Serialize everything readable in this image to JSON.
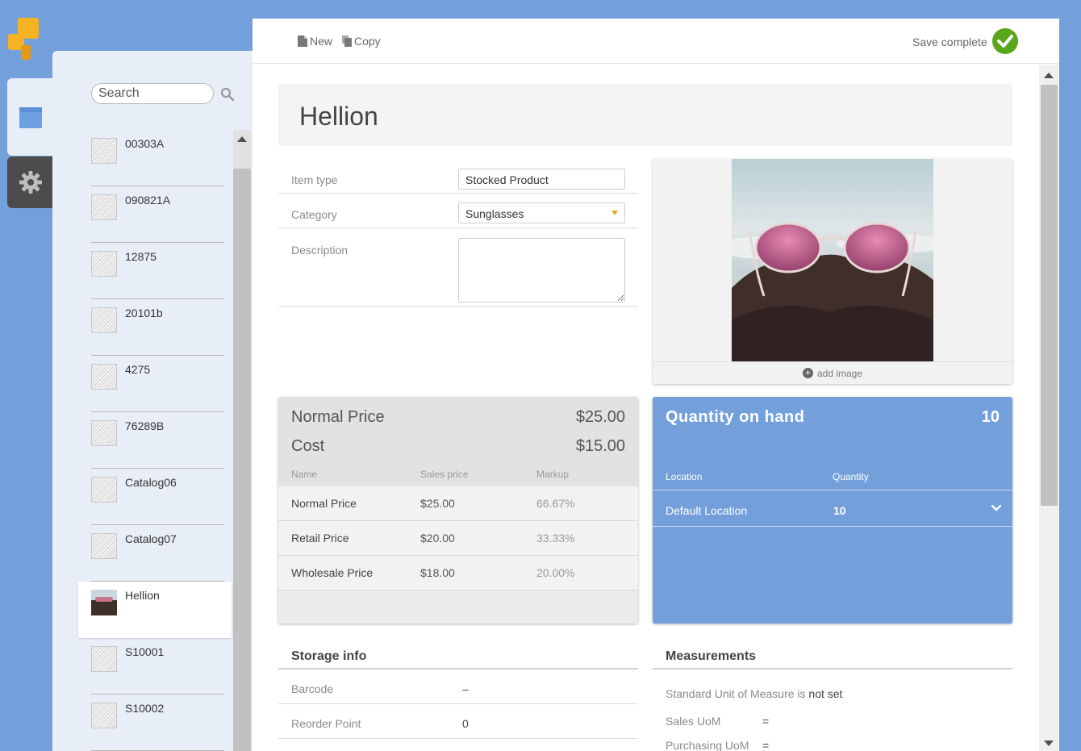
{
  "app": {
    "brand_color": "#f4b224",
    "accent": "#739fdb"
  },
  "rail": {
    "items_icon": "box-icon",
    "settings_icon": "gear-icon"
  },
  "search": {
    "placeholder": "Search"
  },
  "items": [
    {
      "code": "00303A"
    },
    {
      "code": "090821A"
    },
    {
      "code": "12875"
    },
    {
      "code": "20101b"
    },
    {
      "code": "4275"
    },
    {
      "code": "76289B"
    },
    {
      "code": "Catalog06"
    },
    {
      "code": "Catalog07"
    },
    {
      "code": "Hellion",
      "selected": true
    },
    {
      "code": "S10001"
    },
    {
      "code": "S10002"
    }
  ],
  "toolbar": {
    "new_label": "New",
    "copy_label": "Copy",
    "save_status": "Save complete"
  },
  "product": {
    "name": "Hellion",
    "fields": {
      "item_type_label": "Item type",
      "item_type_value": "Stocked Product",
      "category_label": "Category",
      "category_value": "Sunglasses",
      "description_label": "Description",
      "description_value": ""
    },
    "image": {
      "add_label": "add image"
    }
  },
  "pricing": {
    "normal_label": "Normal Price",
    "normal_value": "$25.00",
    "cost_label": "Cost",
    "cost_value": "$15.00",
    "columns": [
      "Name",
      "Sales price",
      "Markup"
    ],
    "rows": [
      {
        "name": "Normal Price",
        "price": "$25.00",
        "markup": "66.67%"
      },
      {
        "name": "Retail Price",
        "price": "$20.00",
        "markup": "33.33%"
      },
      {
        "name": "Wholesale Price",
        "price": "$18.00",
        "markup": "20.00%"
      }
    ]
  },
  "quantity": {
    "title": "Quantity on hand",
    "total": "10",
    "columns": [
      "Location",
      "Quantity"
    ],
    "rows": [
      {
        "location": "Default Location",
        "quantity": "10"
      }
    ]
  },
  "storage": {
    "title": "Storage info",
    "barcode_label": "Barcode",
    "barcode_value": "–",
    "reorder_label": "Reorder Point",
    "reorder_value": "0"
  },
  "measurements": {
    "title": "Measurements",
    "standard_prefix": "Standard Unit of Measure is",
    "standard_value": "not set",
    "sales_label": "Sales UoM",
    "sales_value": "=",
    "purchasing_label": "Purchasing UoM",
    "purchasing_value": "="
  }
}
